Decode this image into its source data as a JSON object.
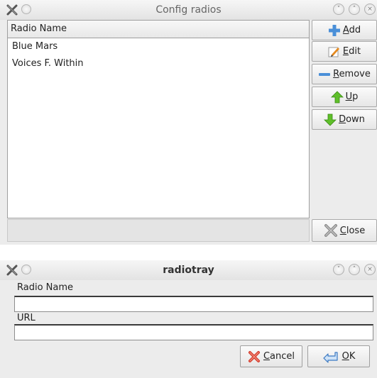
{
  "config_window": {
    "title": "Config radios",
    "column_header": "Radio Name",
    "radios": [
      "Blue Mars",
      "Voices F. Within"
    ],
    "buttons": {
      "add": {
        "mnemonic": "A",
        "rest": "dd"
      },
      "edit": {
        "mnemonic": "E",
        "rest": "dit"
      },
      "remove": {
        "mnemonic": "R",
        "rest": "emove"
      },
      "up": {
        "mnemonic": "U",
        "rest": "p"
      },
      "down": {
        "mnemonic": "D",
        "rest": "own"
      },
      "close": {
        "mnemonic": "C",
        "rest": "lose"
      }
    }
  },
  "edit_dialog": {
    "title": "radiotray",
    "name_label": "Radio Name",
    "name_value": "",
    "url_label": "URL",
    "url_value": "",
    "buttons": {
      "cancel": {
        "mnemonic": "C",
        "rest": "ancel"
      },
      "ok": {
        "mnemonic": "O",
        "rest": "K"
      }
    }
  },
  "icons": {
    "app": "x-wing-app-icon",
    "add": "plus-icon",
    "edit": "pencil-icon",
    "remove": "minus-icon",
    "up": "arrow-up-icon",
    "down": "arrow-down-icon",
    "close": "x-icon",
    "cancel": "x-icon",
    "ok": "return-arrow-icon"
  },
  "colors": {
    "add_plus": "#4a8fd8",
    "up_arrow": "#5fbf2a",
    "down_arrow": "#5fbf2a",
    "close_x": "#8a8a8a",
    "cancel_x": "#d43a2a"
  }
}
